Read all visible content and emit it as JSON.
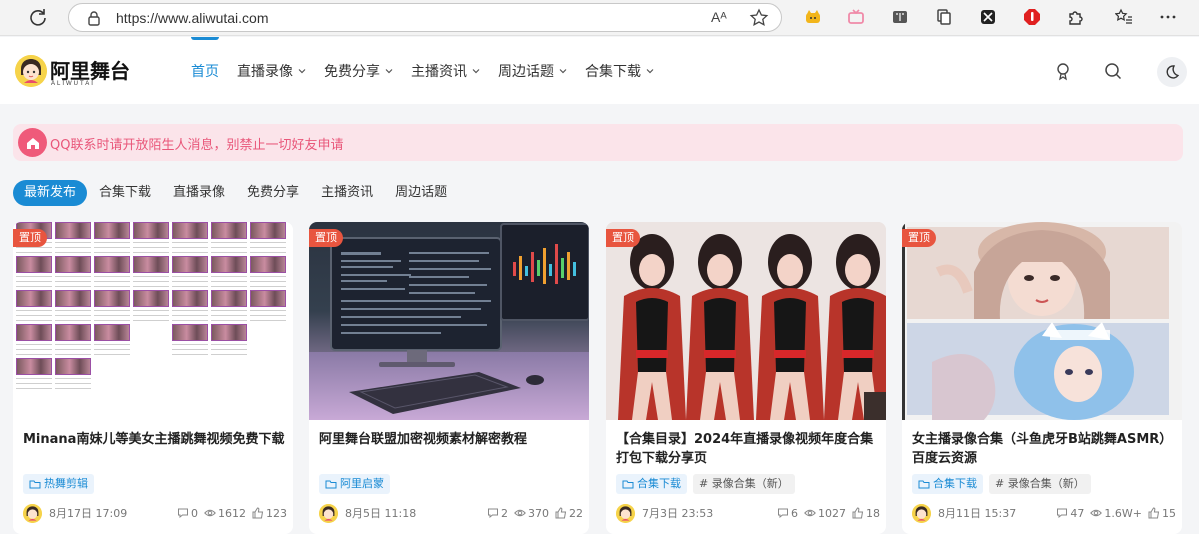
{
  "browser": {
    "url": "https://www.aliwutai.com",
    "read_aloud_label": "Aᴬ"
  },
  "site": {
    "logo_text": "阿里舞台",
    "logo_sub": "ALIWUTAI",
    "nav": [
      {
        "label": "首页",
        "active": true,
        "dropdown": false
      },
      {
        "label": "直播录像",
        "active": false,
        "dropdown": true
      },
      {
        "label": "免费分享",
        "active": false,
        "dropdown": true
      },
      {
        "label": "主播资讯",
        "active": false,
        "dropdown": true
      },
      {
        "label": "周边话题",
        "active": false,
        "dropdown": true
      },
      {
        "label": "合集下载",
        "active": false,
        "dropdown": true
      }
    ]
  },
  "notice": {
    "text": "QQ联系时请开放陌生人消息，别禁止一切好友申请"
  },
  "tabs": [
    "最新发布",
    "合集下载",
    "直播录像",
    "免费分享",
    "主播资讯",
    "周边话题"
  ],
  "cards": [
    {
      "pin": "置顶",
      "title": "Minana南妹儿等美女主播跳舞视频免费下载",
      "tags": [
        {
          "label": "热舞剪辑",
          "type": "category"
        }
      ],
      "date": "8月17日 17:09",
      "comments": "0",
      "views": "1612",
      "likes": "123"
    },
    {
      "pin": "置顶",
      "title": "阿里舞台联盟加密视频素材解密教程",
      "tags": [
        {
          "label": "阿里启蒙",
          "type": "category"
        }
      ],
      "date": "8月5日 11:18",
      "comments": "2",
      "views": "370",
      "likes": "22"
    },
    {
      "pin": "置顶",
      "title": "【合集目录】2024年直播录像视频年度合集打包下载分享页",
      "tags": [
        {
          "label": "合集下载",
          "type": "category"
        },
        {
          "label": "# 录像合集（新）",
          "type": "topic"
        }
      ],
      "date": "7月3日 23:53",
      "comments": "6",
      "views": "1027",
      "likes": "18"
    },
    {
      "pin": "置顶",
      "title": "女主播录像合集（斗鱼虎牙B站跳舞ASMR）百度云资源",
      "tags": [
        {
          "label": "合集下载",
          "type": "category"
        },
        {
          "label": "# 录像合集（新）",
          "type": "topic"
        }
      ],
      "date": "8月11日 15:37",
      "comments": "47",
      "views": "1.6W+",
      "likes": "15"
    }
  ],
  "colors": {
    "accent": "#1a8bd4",
    "notice_bg": "#fbe4ea",
    "notice_text": "#e9577a",
    "pin": "#e8553f"
  }
}
